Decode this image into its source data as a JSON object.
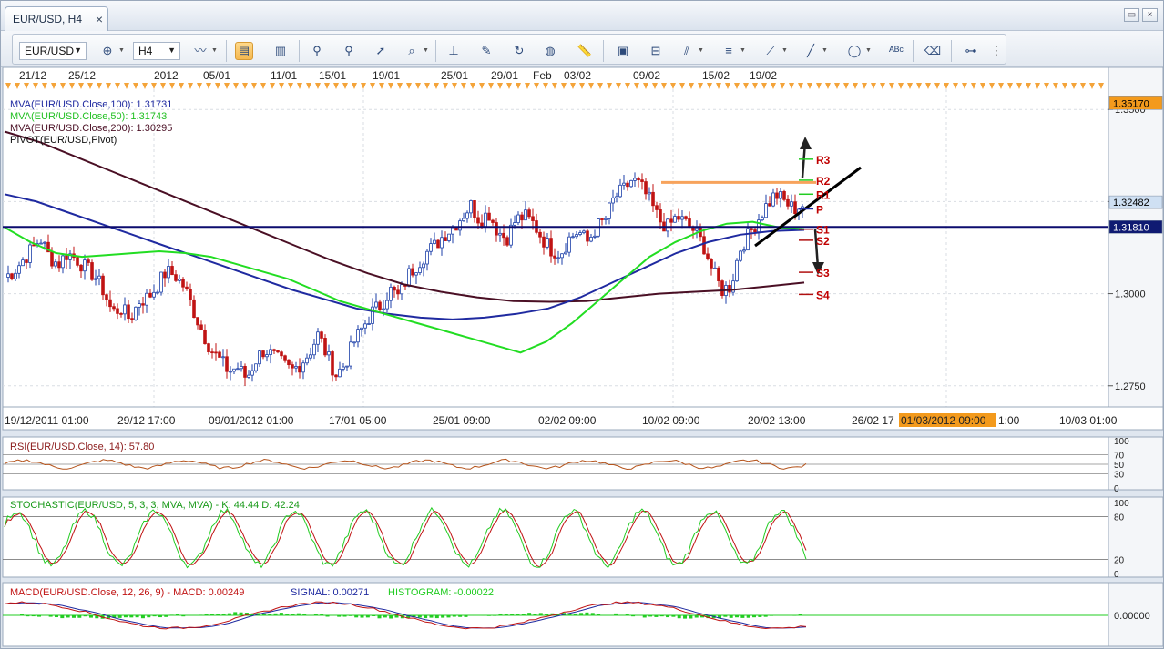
{
  "window": {
    "tab_title": "EUR/USD, H4",
    "close_glyph": "×",
    "buttons": [
      {
        "name": "restore",
        "glyph": "▭"
      },
      {
        "name": "close",
        "glyph": "×"
      }
    ]
  },
  "toolbar": {
    "symbol": "EUR/USD",
    "timeframe": "H4",
    "icons": [
      "bar-chart-icon",
      "crosshair-icon",
      "cursor-icon",
      "properties-icon",
      "candlestick-icon",
      "line-chart-icon",
      "zoom-in-icon",
      "zoom-out-icon",
      "pointer-icon",
      "zoom-rect-icon",
      "period-separator-icon",
      "edit-icon",
      "refresh-icon",
      "globe-icon",
      "ruler-icon",
      "image-icon",
      "template-icon",
      "lines-icon",
      "list-icon",
      "trendline-icon",
      "pencil-icon",
      "ellipse-icon",
      "text-label-icon",
      "eraser-icon",
      "hierarchy-icon"
    ]
  },
  "chart_data": {
    "type": "candlestick",
    "title": "",
    "xlabel": "",
    "ylabel": "",
    "ylim": [
      1.27,
      1.354
    ],
    "colors": {
      "up": "#1c3fa8",
      "down": "#c01313",
      "ma100": "#1f2aa0",
      "ma50": "#22dd22",
      "ma200": "#4a0f24",
      "pivot": "#0c0c6e",
      "resistance": "#f7a35c",
      "pivot_label": "#c00000"
    },
    "top_axis_labels": [
      "21/12",
      "25/12",
      "2012",
      "05/01",
      "11/01",
      "15/01",
      "19/01",
      "25/01",
      "29/01",
      "Feb",
      "03/02",
      "09/02",
      "15/02",
      "19/02"
    ],
    "time_axis_labels": [
      "19/12/2011 01:00",
      "29/12 17:00",
      "09/01/2012 01:00",
      "17/01 05:00",
      "25/01 09:00",
      "02/02 09:00",
      "10/02 09:00",
      "20/02 13:00",
      "26/02 17",
      "01/03/2012 09:00",
      "1:00",
      "10/03 01:00"
    ],
    "highlighted_time": "01/03/2012 09:00",
    "price_ticks": [
      "1.3500",
      "1.3250",
      "1.3000",
      "1.2750"
    ],
    "price_tick_values": [
      1.35,
      1.325,
      1.3,
      1.275
    ],
    "price_badges": [
      {
        "value": 1.3517,
        "label": "1.35170",
        "bg": "#f39a1c"
      },
      {
        "value": 1.32482,
        "label": "1.32482",
        "bg": "#cfe0f3"
      },
      {
        "value": 1.3181,
        "label": "1.31810",
        "bg": "#0f1a72"
      }
    ],
    "indicator_labels": [
      {
        "text": "MVA(EUR/USD.Close,100): 1.31731",
        "color": "#1f2aa0"
      },
      {
        "text": "MVA(EUR/USD.Close,50): 1.31743",
        "color": "#22c022"
      },
      {
        "text": "MVA(EUR/USD.Close,200): 1.30295",
        "color": "#4a0f24"
      },
      {
        "text": "PIVOT(EUR/USD,Pivot)",
        "color": "#111111"
      }
    ],
    "pivot_levels": [
      {
        "name": "R3",
        "value": 1.3365
      },
      {
        "name": "R2",
        "value": 1.3308
      },
      {
        "name": "R1",
        "value": 1.327
      },
      {
        "name": "P",
        "value": 1.323
      },
      {
        "name": "S1",
        "value": 1.3175
      },
      {
        "name": "S2",
        "value": 1.3145
      },
      {
        "name": "S3",
        "value": 1.3058
      },
      {
        "name": "S4",
        "value": 1.2998
      }
    ],
    "close_path": [
      1.3045,
      1.306,
      1.309,
      1.312,
      1.315,
      1.31,
      1.308,
      1.311,
      1.3095,
      1.307,
      1.305,
      1.301,
      1.295,
      1.296,
      1.293,
      1.298,
      1.299,
      1.302,
      1.306,
      1.305,
      1.302,
      1.296,
      1.29,
      1.285,
      1.282,
      1.279,
      1.28,
      1.277,
      1.282,
      1.285,
      1.283,
      1.281,
      1.279,
      1.281,
      1.284,
      1.289,
      1.283,
      1.278,
      1.281,
      1.287,
      1.291,
      1.295,
      1.297,
      1.301,
      1.299,
      1.305,
      1.308,
      1.311,
      1.313,
      1.316,
      1.318,
      1.321,
      1.324,
      1.32,
      1.322,
      1.317,
      1.315,
      1.32,
      1.321,
      1.319,
      1.315,
      1.312,
      1.311,
      1.315,
      1.317,
      1.314,
      1.318,
      1.32,
      1.326,
      1.328,
      1.331,
      1.329,
      1.325,
      1.32,
      1.318,
      1.321,
      1.319,
      1.317,
      1.313,
      1.306,
      1.301,
      1.302,
      1.312,
      1.316,
      1.32,
      1.324,
      1.327,
      1.325,
      1.323,
      1.324
    ],
    "ma50": [
      1.318,
      1.314,
      1.311,
      1.31,
      1.3105,
      1.311,
      1.3115,
      1.311,
      1.31,
      1.308,
      1.306,
      1.304,
      1.301,
      1.298,
      1.296,
      1.294,
      1.292,
      1.29,
      1.288,
      1.286,
      1.284,
      1.287,
      1.292,
      1.298,
      1.304,
      1.31,
      1.314,
      1.317,
      1.319,
      1.3195,
      1.318,
      1.3175
    ],
    "ma100": [
      1.327,
      1.325,
      1.322,
      1.319,
      1.316,
      1.313,
      1.31,
      1.307,
      1.304,
      1.301,
      1.2985,
      1.296,
      1.2945,
      1.2935,
      1.293,
      1.2935,
      1.2945,
      1.296,
      1.299,
      1.303,
      1.307,
      1.311,
      1.314,
      1.316,
      1.317,
      1.3173
    ],
    "ma200": [
      1.344,
      1.341,
      1.337,
      1.333,
      1.329,
      1.325,
      1.321,
      1.317,
      1.313,
      1.309,
      1.3055,
      1.3025,
      1.3005,
      1.299,
      1.298,
      1.2978,
      1.298,
      1.299,
      1.3,
      1.3005,
      1.301,
      1.302,
      1.303
    ],
    "rsi": {
      "label": "RSI(EUR/USD.Close, 14): 57.80",
      "levels": [
        "100",
        "70",
        "50",
        "30",
        "0"
      ]
    },
    "stochastic": {
      "label": "STOCHASTIC(EUR/USD, 5, 3, 3, MVA, MVA) -  K: 44.44   D: 42.24",
      "levels": [
        "100",
        "80",
        "20",
        "0"
      ]
    },
    "macd": {
      "label_main": "MACD(EUR/USD.Close, 12, 26, 9) -  MACD: 0.00249",
      "label_signal": "SIGNAL: 0.00271",
      "label_hist": "HISTOGRAM: -0.00022",
      "zero_label": "0.00000"
    }
  }
}
